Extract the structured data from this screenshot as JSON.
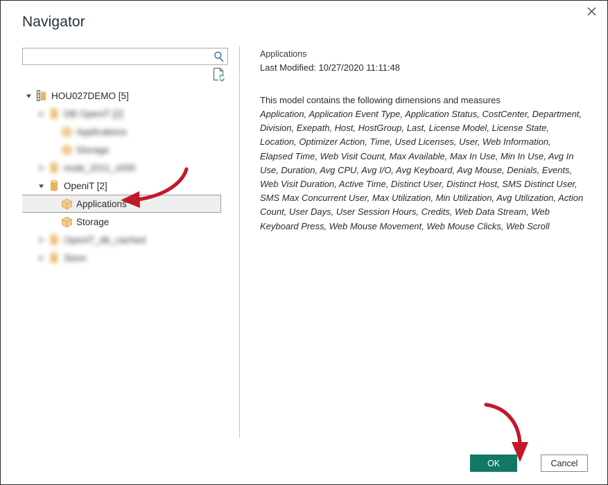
{
  "dialog": {
    "title": "Navigator",
    "close_label": "✕"
  },
  "search": {
    "value": "",
    "placeholder": ""
  },
  "tree": {
    "nodes": [
      {
        "label": "HOU027DEMO [5]",
        "level": 0,
        "icon": "server-icon",
        "twisty": "expanded",
        "selected": false,
        "blurred": false
      },
      {
        "label": "DB OpeniT [2]",
        "level": 1,
        "icon": "database-icon",
        "twisty": "collapsed",
        "selected": false,
        "blurred": true
      },
      {
        "label": "Applications",
        "level": 2,
        "icon": "cube-icon",
        "twisty": "none",
        "selected": false,
        "blurred": true
      },
      {
        "label": "Storage",
        "level": 2,
        "icon": "cube-icon",
        "twisty": "none",
        "selected": false,
        "blurred": true
      },
      {
        "label": "node_2011_x000",
        "level": 1,
        "icon": "database-icon",
        "twisty": "collapsed",
        "selected": false,
        "blurred": true
      },
      {
        "label": "OpeniT [2]",
        "level": 1,
        "icon": "database-icon",
        "twisty": "expanded",
        "selected": false,
        "blurred": false
      },
      {
        "label": "Applications",
        "level": 2,
        "icon": "cube-icon",
        "twisty": "none",
        "selected": true,
        "blurred": false
      },
      {
        "label": "Storage",
        "level": 2,
        "icon": "cube-icon",
        "twisty": "none",
        "selected": false,
        "blurred": false
      },
      {
        "label": "OpeniT_db_cached",
        "level": 1,
        "icon": "database-icon",
        "twisty": "collapsed",
        "selected": false,
        "blurred": true
      },
      {
        "label": "Store",
        "level": 1,
        "icon": "database-icon",
        "twisty": "collapsed",
        "selected": false,
        "blurred": true
      }
    ]
  },
  "preview": {
    "name": "Applications",
    "last_modified": "Last Modified: 10/27/2020 11:11:48",
    "intro": "This model contains the following dimensions and measures",
    "measures": "Application, Application Event Type, Application Status, CostCenter, Department, Division, Exepath, Host, HostGroup, Last, License Model, License State, Location, Optimizer Action, Time, Used Licenses, User, Web Information, Elapsed Time, Web Visit Count, Max Available, Max In Use, Min In Use, Avg In Use, Duration, Avg CPU, Avg I/O, Avg Keyboard, Avg Mouse, Denials, Events, Web Visit Duration, Active Time, Distinct User, Distinct Host, SMS Distinct User, SMS Max Concurrent User, Max Utilization, Min Utilization, Avg Utilization, Action Count, User Days, User Session Hours, Credits, Web Data Stream, Web Keyboard Press, Web Mouse Movement, Web Mouse Clicks, Web Scroll"
  },
  "footer": {
    "ok_label": "OK",
    "cancel_label": "Cancel"
  },
  "colors": {
    "ok_button": "#117865",
    "annotation_arrow": "#c2182b",
    "selection": "#efefef",
    "title_text": "#25303b"
  }
}
